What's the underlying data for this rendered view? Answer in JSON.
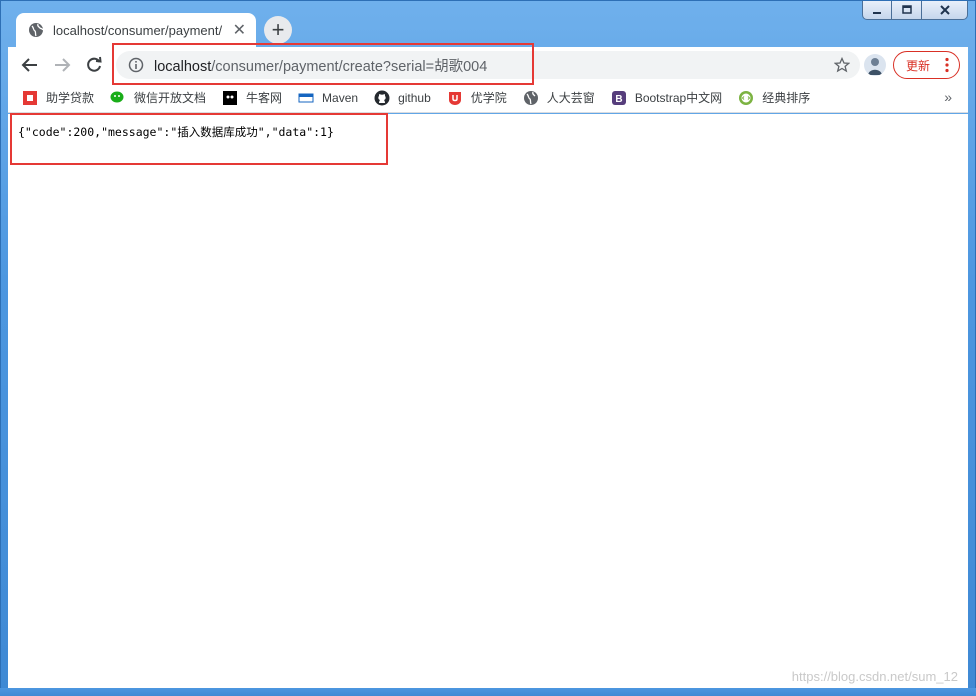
{
  "window": {
    "controls": {
      "minimize": "minimize",
      "maximize": "maximize",
      "close": "close"
    }
  },
  "tab": {
    "title": "localhost/consumer/payment/",
    "icon": "globe-icon"
  },
  "toolbar": {
    "url_host": "localhost",
    "url_path": "/consumer/payment/create?serial=胡歌004",
    "update_label": "更新"
  },
  "bookmarks": [
    {
      "label": "助学贷款",
      "icon": "loan-icon",
      "color": "#e53935"
    },
    {
      "label": "微信开放文档",
      "icon": "wechat-icon",
      "color": "#1aad19"
    },
    {
      "label": "牛客网",
      "icon": "nowcoder-icon",
      "color": "#000000"
    },
    {
      "label": "Maven",
      "icon": "maven-icon",
      "color": "#1565c0"
    },
    {
      "label": "github",
      "icon": "github-icon",
      "color": "#24292e"
    },
    {
      "label": "优学院",
      "icon": "ulearning-icon",
      "color": "#e53935"
    },
    {
      "label": "人大芸窗",
      "icon": "globe-icon",
      "color": "#5f6368"
    },
    {
      "label": "Bootstrap中文网",
      "icon": "bootstrap-icon",
      "color": "#563d7c"
    },
    {
      "label": "经典排序",
      "icon": "code-icon",
      "color": "#7cb342"
    }
  ],
  "bookmarks_more": "»",
  "page": {
    "json_text": "{\"code\":200,\"message\":\"插入数据库成功\",\"data\":1}"
  },
  "watermark": "https://blog.csdn.net/sum_12",
  "colors": {
    "highlight": "#e53935",
    "accent": "#1a73e8"
  }
}
